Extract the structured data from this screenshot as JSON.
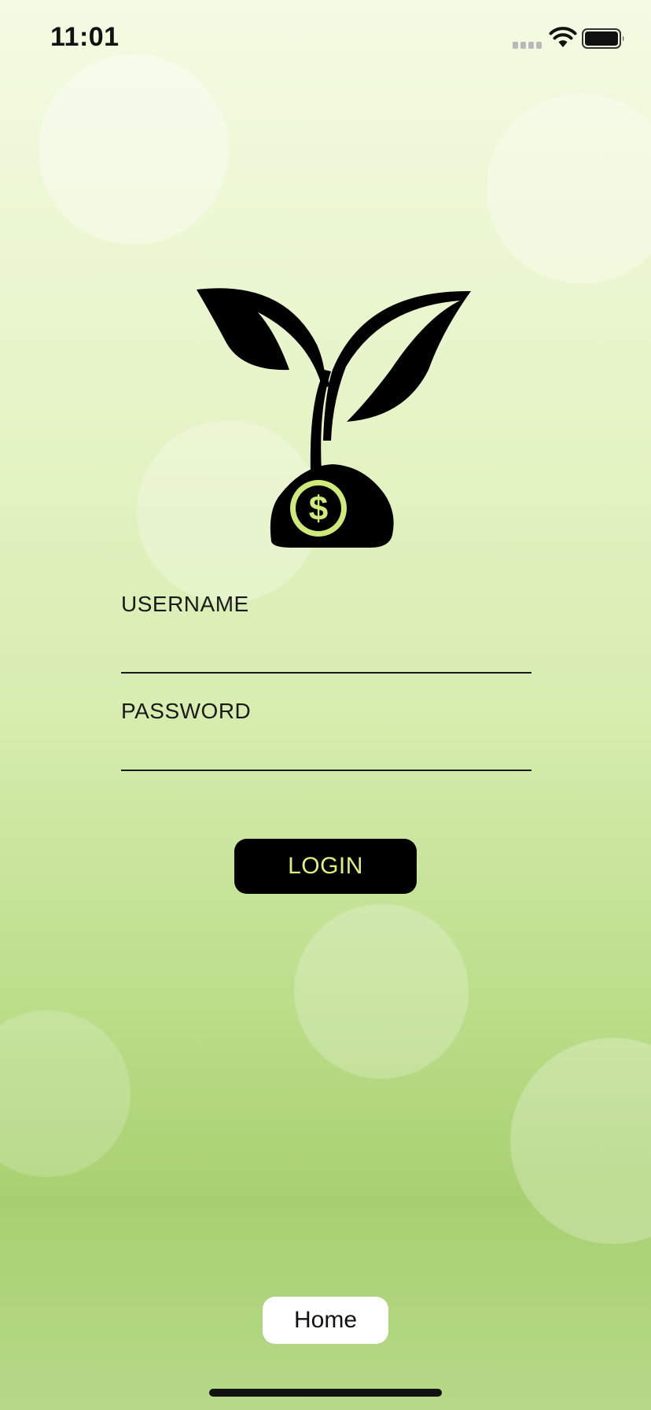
{
  "status_bar": {
    "time": "11:01",
    "icons": [
      "cellular-signal-icon",
      "wifi-icon",
      "battery-icon"
    ]
  },
  "logo": {
    "icon": "sprout-dollar-logo-icon",
    "colors": {
      "primary": "#000000",
      "accent": "#cfe97a"
    }
  },
  "login_form": {
    "username_label": "USERNAME",
    "username_value": "",
    "password_label": "PASSWORD",
    "password_value": "",
    "login_button_label": "LOGIN"
  },
  "bottom": {
    "home_button_label": "Home"
  },
  "colors": {
    "button_bg": "#000000",
    "login_text": "#dcf27a",
    "home_button_bg": "#ffffff"
  }
}
